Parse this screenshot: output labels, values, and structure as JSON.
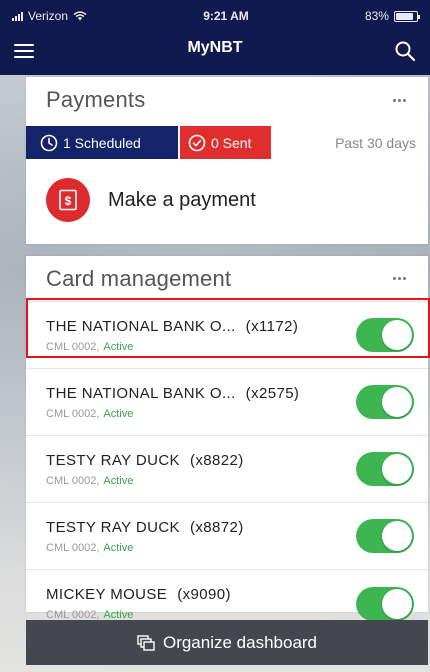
{
  "status_bar": {
    "carrier": "Verizon",
    "time": "9:21 AM",
    "battery": "83%"
  },
  "nav": {
    "title": "MyNBT",
    "menu_icon": "hamburger-menu-icon",
    "search_icon": "search-icon"
  },
  "payments": {
    "title": "Payments",
    "scheduled_label": "1 Scheduled",
    "sent_label": "0 Sent",
    "period_label": "Past 30 days",
    "make_payment_label": "Make a payment",
    "colors": {
      "scheduled": "#14236a",
      "sent": "#e02d2e"
    }
  },
  "card_management": {
    "title": "Card management",
    "accounts": [
      {
        "name": "THE NATIONAL BANK O...",
        "number": "(x1172)",
        "code": "CML 0002,",
        "status": "Active",
        "enabled": true
      },
      {
        "name": "THE NATIONAL BANK O...",
        "number": "(x2575)",
        "code": "CML 0002,",
        "status": "Active",
        "enabled": true
      },
      {
        "name": "TESTY RAY DUCK",
        "number": "(x8822)",
        "code": "CML 0002,",
        "status": "Active",
        "enabled": true
      },
      {
        "name": "TESTY RAY DUCK",
        "number": "(x8872)",
        "code": "CML 0002,",
        "status": "Active",
        "enabled": true
      },
      {
        "name": "MICKEY MOUSE",
        "number": "(x9090)",
        "code": "CML 0002,",
        "status": "Active",
        "enabled": true
      }
    ]
  },
  "footer": {
    "organize_label": "Organize dashboard"
  },
  "colors": {
    "nav_bg": "#101a4e",
    "toggle_on": "#3db652",
    "highlight": "#e4141b"
  }
}
